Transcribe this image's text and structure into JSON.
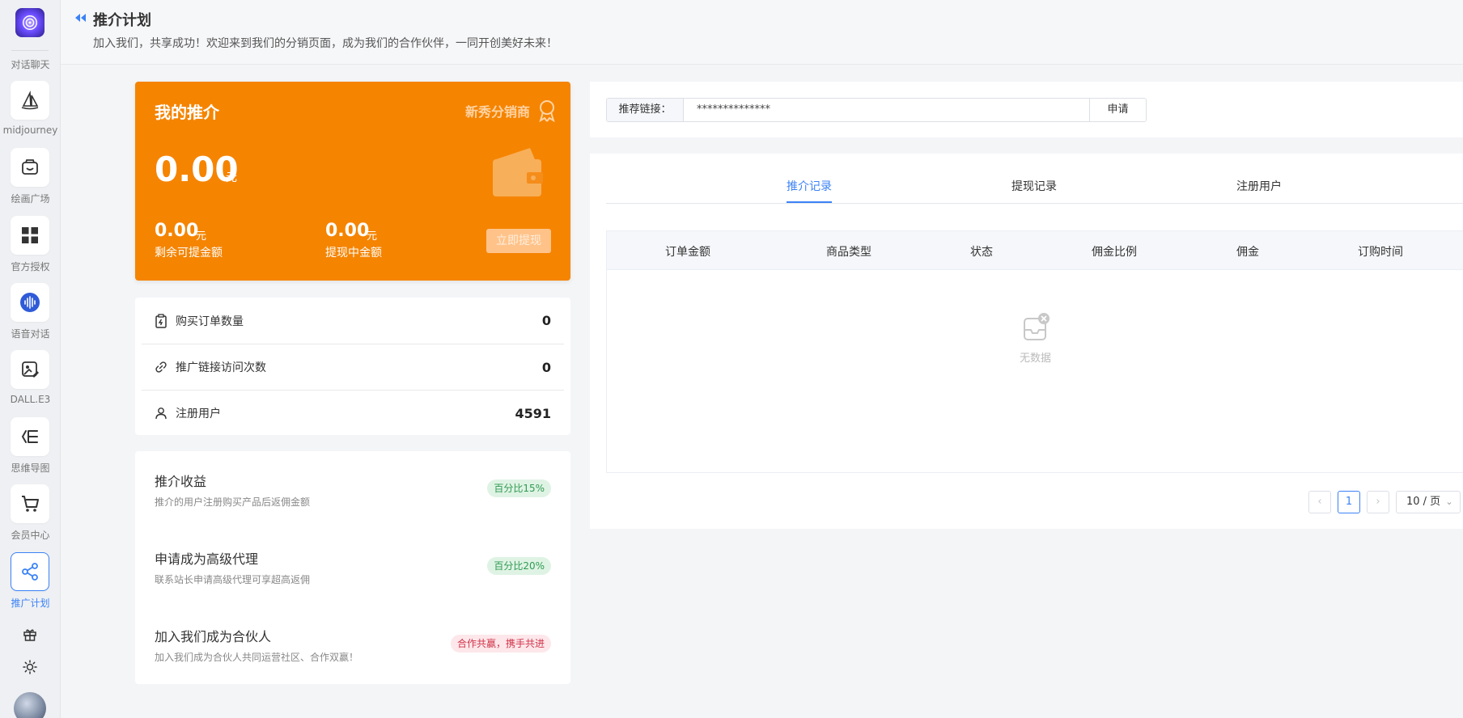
{
  "sidebar": {
    "items": [
      {
        "label": "对话聊天",
        "icon": "chat-icon"
      },
      {
        "label": "midjourney",
        "icon": "sailboat-icon"
      },
      {
        "label": "绘画广场",
        "icon": "gallery-icon"
      },
      {
        "label": "官方授权",
        "icon": "grid-icon"
      },
      {
        "label": "语音对话",
        "icon": "voice-icon"
      },
      {
        "label": "DALL.E3",
        "icon": "image-edit-icon"
      },
      {
        "label": "思维导图",
        "icon": "mindmap-icon"
      },
      {
        "label": "会员中心",
        "icon": "cart-icon"
      },
      {
        "label": "推广计划",
        "icon": "share-icon",
        "active": true
      }
    ],
    "bottom_icons": [
      "gift-icon",
      "sun-icon"
    ]
  },
  "header": {
    "title": "推介计划",
    "subtitle": "加入我们，共享成功！欢迎来到我们的分销页面，成为我们的合作伙伴，一同开创美好未来！"
  },
  "referral_card": {
    "title": "我的推介",
    "badge": "新秀分销商",
    "amount": "0.00",
    "unit": "元",
    "remaining_amount": "0.00",
    "remaining_unit": "元",
    "remaining_label": "剩余可提金额",
    "pending_amount": "0.00",
    "pending_unit": "元",
    "pending_label": "提现中金额",
    "withdraw_button": "立即提现"
  },
  "stats": [
    {
      "label": "购买订单数量",
      "value": "0",
      "icon": "order-icon"
    },
    {
      "label": "推广链接访问次数",
      "value": "0",
      "icon": "link-icon"
    },
    {
      "label": "注册用户",
      "value": "4591",
      "icon": "user-icon"
    }
  ],
  "benefits": [
    {
      "title": "推介收益",
      "desc": "推介的用户注册购买产品后返佣金额",
      "tag": "百分比15%",
      "tag_color": "green"
    },
    {
      "title": "申请成为高级代理",
      "desc": "联系站长申请高级代理可享超高返佣",
      "tag": "百分比20%",
      "tag_color": "green"
    },
    {
      "title": "加入我们成为合伙人",
      "desc": "加入我们成为合伙人共同运营社区、合作双赢！",
      "tag": "合作共赢，携手共进",
      "tag_color": "red"
    }
  ],
  "link_bar": {
    "label": "推荐链接：",
    "value": "**************",
    "button": "申请"
  },
  "records": {
    "tabs": [
      "推介记录",
      "提现记录",
      "注册用户"
    ],
    "active_tab": 0,
    "columns": [
      "订单金额",
      "商品类型",
      "状态",
      "佣金比例",
      "佣金",
      "订购时间"
    ],
    "empty_text": "无数据",
    "pagination": {
      "current_page": "1",
      "page_size": "10 / 页"
    }
  },
  "colors": {
    "accent": "#3b82f6",
    "orange": "#f58400"
  }
}
